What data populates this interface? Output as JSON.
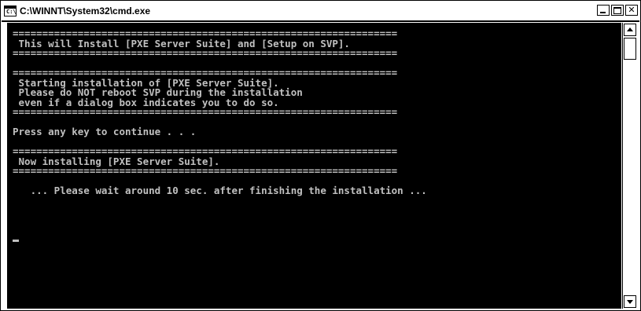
{
  "window": {
    "title": "C:\\WINNT\\System32\\cmd.exe",
    "icon": "cmd-console-icon",
    "icon_glyph": "C:\\",
    "buttons": {
      "minimize": "minimize-icon",
      "maximize": "maximize-icon",
      "close": "close-icon",
      "close_glyph": "✕"
    }
  },
  "console": {
    "background": "#000000",
    "foreground": "#c0c0c0",
    "lines": [
      "=================================================================",
      " This will Install [PXE Server Suite] and [Setup on SVP].",
      "=================================================================",
      "",
      "=================================================================",
      " Starting installation of [PXE Server Suite].",
      " Please do NOT reboot SVP during the installation",
      " even if a dialog box indicates you to do so.",
      "=================================================================",
      "",
      "Press any key to continue . . .",
      "",
      "=================================================================",
      " Now installing [PXE Server Suite].",
      "=================================================================",
      "",
      "   ... Please wait around 10 sec. after finishing the installation ..."
    ]
  },
  "scrollbar": {
    "up_icon": "scroll-up-arrow-icon",
    "down_icon": "scroll-down-arrow-icon",
    "position_fraction": 0.0
  }
}
